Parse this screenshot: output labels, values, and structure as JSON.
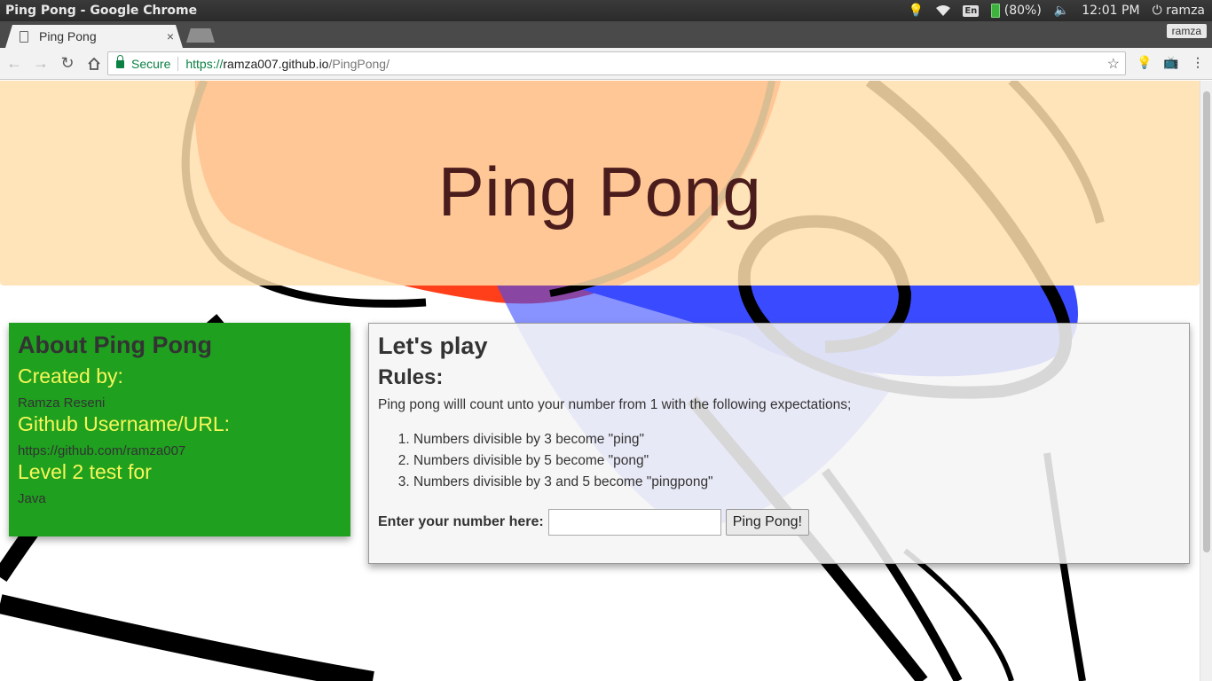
{
  "os": {
    "window_title": "Ping Pong - Google Chrome",
    "lang": "En",
    "battery": "(80%)",
    "time": "12:01 PM",
    "user": "ramza"
  },
  "browser": {
    "tab_title": "Ping Pong",
    "tab_close": "×",
    "profile": "ramza",
    "secure_label": "Secure",
    "url_scheme": "https://",
    "url_host": "ramza007.github.io",
    "url_path": "/PingPong/"
  },
  "jumbotron": {
    "title": "Ping Pong"
  },
  "about": {
    "heading": "About Ping Pong",
    "created_by_label": "Created by:",
    "created_by_value": "Ramza Reseni",
    "github_label": "Github Username/URL:",
    "github_value": "https://github.com/ramza007",
    "level_label": "Level 2 test for",
    "level_value": "Java"
  },
  "play": {
    "heading": "Let's play",
    "rules_heading": "Rules:",
    "intro": "Ping pong willl count unto your number from 1 with the following expectations;",
    "rules": [
      "Numbers divisible by 3 become \"ping\"",
      "Numbers divisible by 5 become \"pong\"",
      "Numbers divisible by 3 and 5 become \"pingpong\""
    ],
    "input_label": "Enter your number here:",
    "input_value": "",
    "button_label": "Ping Pong!"
  },
  "colors": {
    "jumbotron_bg": "#ffdead",
    "about_bg": "#1fa01f",
    "about_subheading": "#f7f75a",
    "title_text": "#4a1c1c"
  }
}
